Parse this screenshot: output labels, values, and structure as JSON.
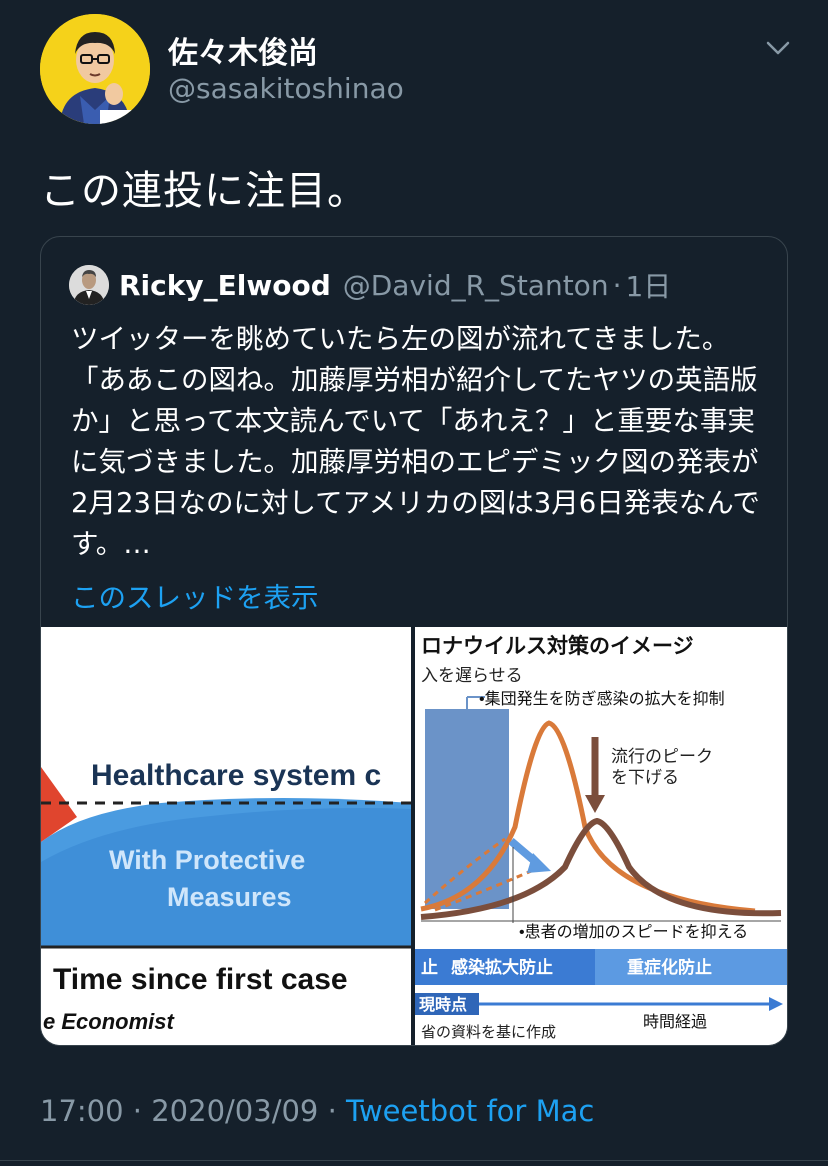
{
  "author": {
    "name": "佐々木俊尚",
    "handle": "@sasakitoshinao"
  },
  "tweet": {
    "text": "この連投に注目。"
  },
  "quoted": {
    "name": "Ricky_Elwood",
    "handle": "@David_R_Stanton",
    "separator": "·",
    "time": "1日",
    "text": "ツイッターを眺めていたら左の図が流れてきました。「ああこの図ね。加藤厚労相が紹介してたヤツの英語版か」と思って本文読んでいて「あれえ？」と重要な事実に気づきました。加藤厚労相のエピデミック図の発表が2月23日なのに対してアメリカの図は3月6日発表なんです。…",
    "show_thread": "このスレッドを表示"
  },
  "media_left": {
    "healthcare_label": "Healthcare system c",
    "protective_line1": "With Protective",
    "protective_line2": "Measures",
    "x_axis_label": "Time since first case",
    "source": "e Economist"
  },
  "media_right": {
    "title": "ロナウイルス対策のイメージ",
    "note_delay": "入を遅らせる",
    "note_cluster": "•集団発生を防ぎ感染の拡大を抑制",
    "note_peak_1": "流行のピーク",
    "note_peak_2": "を下げる",
    "note_speed": "•患者の増加のスピードを抑える",
    "band_left": "止",
    "band_mid": "感染拡大防止",
    "band_right": "重症化防止",
    "timeline_now": "現時点",
    "timeline_elapsed": "時間経過",
    "source": "省の資料を基に作成"
  },
  "footer": {
    "time": "17:00",
    "sep1": " · ",
    "date": "2020/03/09",
    "sep2": " · ",
    "client": "Tweetbot for Mac"
  },
  "colors": {
    "background": "#15202b",
    "link": "#1da1f2",
    "muted": "#8899a6",
    "border": "#38444d"
  }
}
